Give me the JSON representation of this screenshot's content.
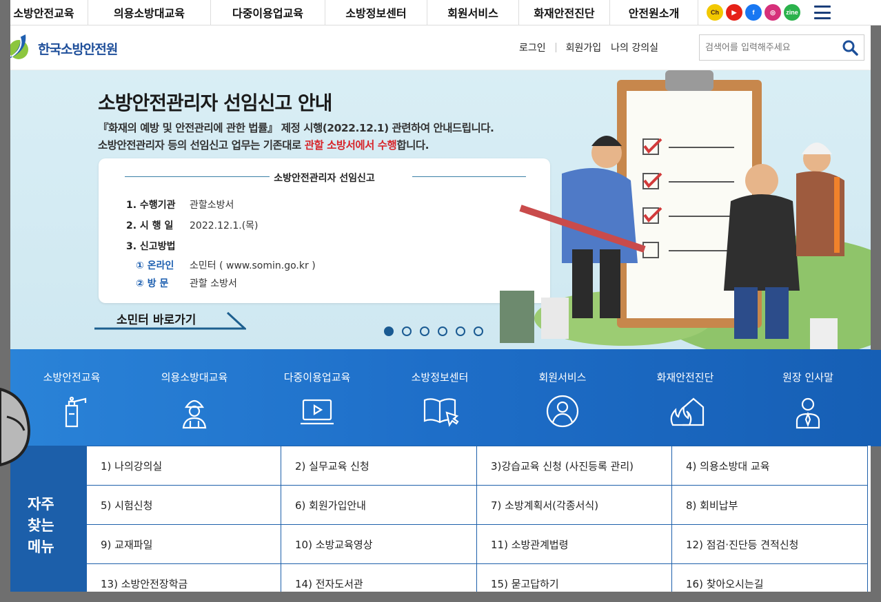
{
  "topnav": {
    "items": [
      "소방안전교육",
      "의용소방대교육",
      "다중이용업교육",
      "소방정보센터",
      "회원서비스",
      "화재안전진단",
      "안전원소개"
    ],
    "socials": [
      {
        "name": "kakao-channel-icon",
        "label": "Ch",
        "color": "#f2c800"
      },
      {
        "name": "youtube-icon",
        "label": "▶",
        "color": "#e62117"
      },
      {
        "name": "facebook-icon",
        "label": "f",
        "color": "#1877f2"
      },
      {
        "name": "instagram-icon",
        "label": "◎",
        "color": "#d6307a"
      },
      {
        "name": "webzine-icon",
        "label": "zine",
        "color": "#2bb24c"
      }
    ]
  },
  "header": {
    "logo_text": "한국소방안전원",
    "login": "로그인",
    "join": "회원가입",
    "myclass": "나의 강의실",
    "search_placeholder": "검색어를 입력해주세요"
  },
  "banner": {
    "title": "소방안전관리자 선임신고 안내",
    "sub1": "『화재의 예방 및 안전관리에 관한 법률』 제정 시행(2022.12.1) 관련하여 안내드립니다.",
    "sub2_pre": "소방안전관리자 등의 선임신고 업무는 기존대로 ",
    "sub2_red": "관할 소방서에서 수행",
    "sub2_post": "합니다.",
    "card_title": "소방안전관리자 선임신고",
    "rows": [
      {
        "k": "1. 수행기관",
        "v": "관할소방서"
      },
      {
        "k": "2. 시 행 일",
        "v": "2022.12.1.(목)"
      },
      {
        "k": "3. 신고방법",
        "v": ""
      }
    ],
    "subrows": [
      {
        "k": "① 온라인",
        "v": "소민터 ( www.somin.go.kr )"
      },
      {
        "k": "② 방  문",
        "v": "관할 소방서"
      }
    ],
    "shortcut": "소민터 바로가기",
    "slides": 6,
    "active_slide": 1
  },
  "quickmenu": [
    {
      "label": "소방안전교육",
      "icon": "fire-extinguisher-icon"
    },
    {
      "label": "의용소방대교육",
      "icon": "firefighter-icon"
    },
    {
      "label": "다중이용업교육",
      "icon": "laptop-play-icon"
    },
    {
      "label": "소방정보센터",
      "icon": "book-cursor-icon"
    },
    {
      "label": "회원서비스",
      "icon": "user-circle-icon"
    },
    {
      "label": "화재안전진단",
      "icon": "house-fire-icon"
    },
    {
      "label": "원장 인사말",
      "icon": "person-tie-icon"
    }
  ],
  "frequent": {
    "title_lines": [
      "자주",
      "찾는",
      "메뉴"
    ],
    "items": [
      "1) 나의강의실",
      "2) 실무교육 신청",
      "3)강습교육 신청 (사진등록 관리)",
      "4) 의용소방대 교육",
      "5) 시험신청",
      "6) 회원가입안내",
      "7) 소방계획서(각종서식)",
      "8) 회비납부",
      "9) 교재파일",
      "10) 소방교육영상",
      "11) 소방관계법령",
      "12) 점검·진단등 견적신청",
      "13) 소방안전장학금",
      "14) 전자도서관",
      "15) 묻고답하기",
      "16) 찾아오시는길"
    ]
  }
}
